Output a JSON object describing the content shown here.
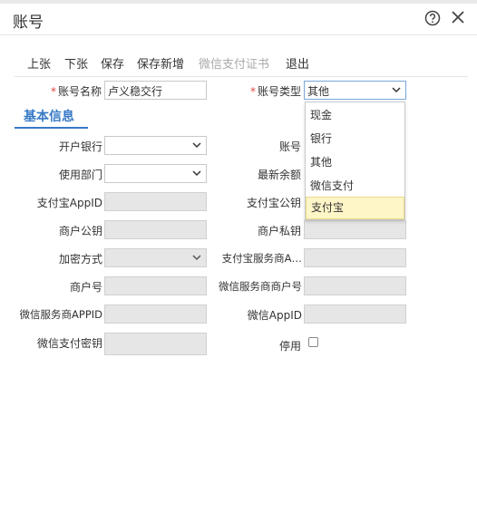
{
  "window": {
    "title": "账号"
  },
  "toolbar": {
    "prev": "上张",
    "next": "下张",
    "save": "保存",
    "save_new": "保存新增",
    "wechat_cert": "微信支付证书",
    "exit": "退出"
  },
  "form": {
    "account_name": {
      "label": "账号名称",
      "value": "卢义稳交行"
    },
    "account_type": {
      "label": "账号类型",
      "value": "其他"
    },
    "section_title": "基本信息",
    "bank": {
      "label": "开户银行",
      "value": ""
    },
    "account_no": {
      "label": "账号",
      "value": ""
    },
    "department": {
      "label": "使用部门",
      "value": ""
    },
    "balance": {
      "label": "最新余额",
      "value": ""
    },
    "alipay_appid": {
      "label": "支付宝AppID",
      "value": ""
    },
    "alipay_pubkey": {
      "label": "支付宝公钥",
      "value": ""
    },
    "merchant_pubkey": {
      "label": "商户公钥",
      "value": ""
    },
    "merchant_privkey": {
      "label": "商户私钥",
      "value": ""
    },
    "encryption": {
      "label": "加密方式",
      "value": ""
    },
    "alipay_sp": {
      "label": "支付宝服务商A…",
      "value": ""
    },
    "merchant_no": {
      "label": "商户号",
      "value": ""
    },
    "wechat_sp_merchant": {
      "label": "微信服务商商户号",
      "value": ""
    },
    "wechat_sp_appid": {
      "label": "微信服务商APPID",
      "value": ""
    },
    "wechat_appid": {
      "label": "微信AppID",
      "value": ""
    },
    "wechat_key": {
      "label": "微信支付密钥",
      "value": ""
    },
    "disabled": {
      "label": "停用",
      "checked": false
    }
  },
  "dropdown": {
    "options": [
      "现金",
      "银行",
      "其他",
      "微信支付",
      "支付宝"
    ],
    "highlighted": "支付宝"
  },
  "colors": {
    "accent": "#3779c6",
    "required": "#e0463c",
    "highlight": "#fff6c8"
  }
}
